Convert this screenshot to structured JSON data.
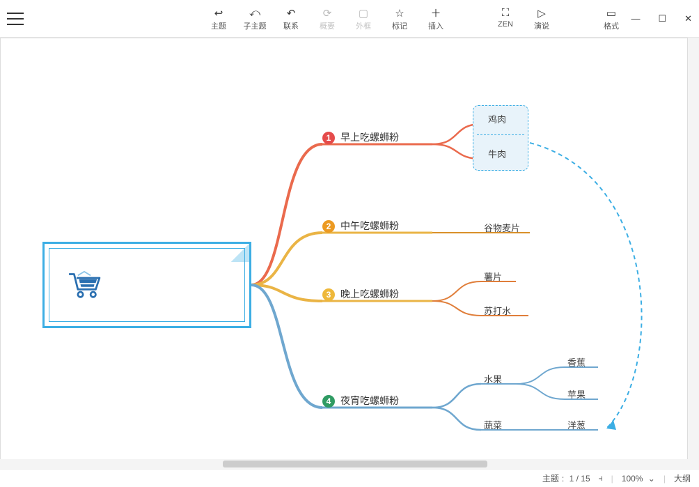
{
  "toolbar": {
    "items": [
      {
        "icon": "↩",
        "label": "主题"
      },
      {
        "icon": "⤺",
        "label": "子主题"
      },
      {
        "icon": "↶",
        "label": "联系"
      },
      {
        "icon": "⟳",
        "label": "概要",
        "disabled": true
      },
      {
        "icon": "▢",
        "label": "外框",
        "disabled": true
      },
      {
        "icon": "☆",
        "label": "标记"
      },
      {
        "icon": "＋",
        "label": "插入"
      }
    ],
    "right": [
      {
        "icon": "⛶",
        "label": "ZEN"
      },
      {
        "icon": "▷",
        "label": "演说"
      }
    ],
    "far": [
      {
        "icon": "▭",
        "label": "格式"
      }
    ]
  },
  "mindmap": {
    "branches": [
      {
        "num": "1",
        "color": "#e54b4b",
        "label": "早上吃螺蛳粉",
        "children": [
          {
            "label": "鸡肉"
          },
          {
            "label": "牛肉"
          }
        ],
        "boxed": true
      },
      {
        "num": "2",
        "color": "#ec9a22",
        "label": "中午吃螺蛳粉",
        "children": [
          {
            "label": "谷物麦片",
            "color": "#d9902a"
          }
        ]
      },
      {
        "num": "3",
        "color": "#eeb83a",
        "label": "晚上吃螺蛳粉",
        "children": [
          {
            "label": "薯片",
            "color": "#e07e3a"
          },
          {
            "label": "苏打水",
            "color": "#e07e3a"
          }
        ]
      },
      {
        "num": "4",
        "color": "#2f9b63",
        "label": "夜宵吃螺蛳粉",
        "lineColor": "#6fa7cf",
        "children": [
          {
            "label": "水果",
            "children": [
              {
                "label": "香蕉"
              },
              {
                "label": "苹果"
              }
            ]
          },
          {
            "label": "蔬菜",
            "children": [
              {
                "label": "洋葱"
              }
            ]
          }
        ]
      }
    ]
  },
  "status": {
    "topic_label": "主题",
    "topic_count": "1 / 15",
    "zoom": "100%",
    "outline": "大纲"
  },
  "window": {
    "min": "—",
    "max": "☐",
    "close": "✕"
  }
}
